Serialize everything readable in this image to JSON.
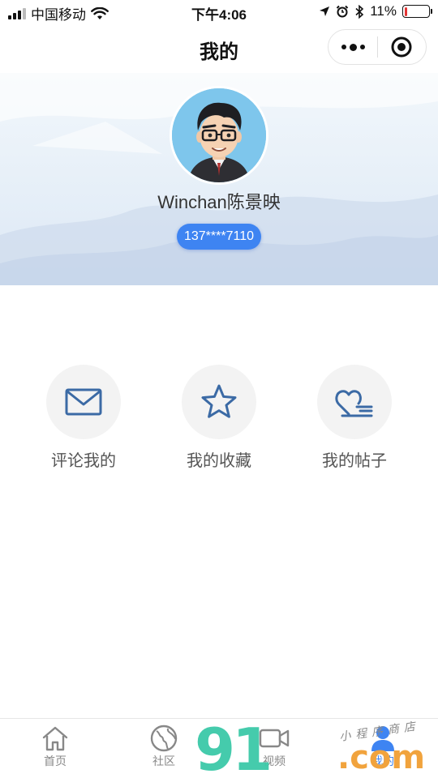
{
  "status_bar": {
    "carrier": "中国移动",
    "time": "下午4:06",
    "battery_percent": "11%",
    "battery_level": 0.11,
    "icons": [
      "signal-icon",
      "wifi-icon",
      "location-icon",
      "alarm-icon",
      "bluetooth-icon",
      "battery-icon"
    ]
  },
  "nav": {
    "title": "我的",
    "more_icon": "more-dots-icon",
    "close_icon": "target-close-icon"
  },
  "profile": {
    "name": "Winchan陈景映",
    "phone": "137****7110",
    "avatar_icon": "cartoon-avatar"
  },
  "features": [
    {
      "label": "评论我的",
      "icon": "envelope-icon"
    },
    {
      "label": "我的收藏",
      "icon": "star-icon"
    },
    {
      "label": "我的帖子",
      "icon": "heart-list-icon"
    }
  ],
  "tabs": [
    {
      "label": "首页",
      "icon": "home-icon"
    },
    {
      "label": "社区",
      "icon": "globe-icon"
    },
    {
      "label": "视频",
      "icon": "video-icon"
    },
    {
      "label": "我的",
      "icon": "user-icon"
    }
  ],
  "watermark": {
    "number": "91",
    "suffix": ".com",
    "caption": "小程序商店"
  },
  "colors": {
    "accent": "#3e84f2",
    "icon_blue": "#3b6aa5",
    "battery_low": "#e33333"
  }
}
